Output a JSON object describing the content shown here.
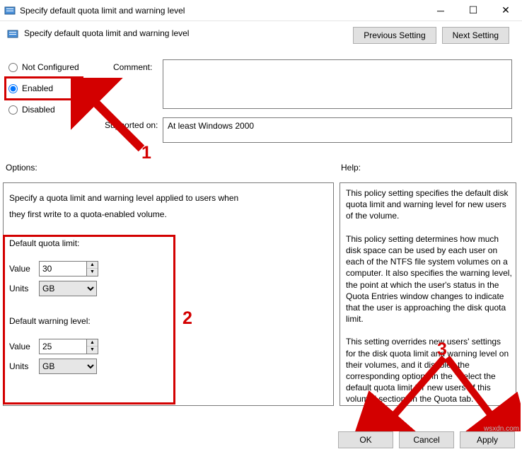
{
  "window": {
    "title": "Specify default quota limit and warning level",
    "subtitle": "Specify default quota limit and warning level"
  },
  "nav": {
    "prev": "Previous Setting",
    "next": "Next Setting"
  },
  "state": {
    "not_configured": "Not Configured",
    "enabled": "Enabled",
    "disabled": "Disabled",
    "selected": "enabled"
  },
  "labels": {
    "comment": "Comment:",
    "supported": "Supported on:",
    "options": "Options:",
    "help": "Help:"
  },
  "comment_value": "",
  "supported_value": "At least Windows 2000",
  "options": {
    "intro_line1": "Specify a quota limit and warning level applied to users when",
    "intro_line2": "they first write to a quota-enabled volume.",
    "limit_label": "Default quota limit:",
    "warn_label": "Default warning level:",
    "value_label": "Value",
    "units_label": "Units",
    "limit_value": "30",
    "limit_units": "GB",
    "warn_value": "25",
    "warn_units": "GB"
  },
  "help_text": "This policy setting specifies the default disk quota limit and warning level for new users of the volume.\n\nThis policy setting determines how much disk space can be used by each user on each of the NTFS file system volumes on a computer. It also specifies the warning level, the point at which the user's status in the Quota Entries window changes to indicate that the user is approaching the disk quota limit.\n\nThis setting overrides new users' settings for the disk quota limit and warning level on their volumes, and it disables the corresponding options in the \"Select the default quota limit for new users of this volume\" section on the Quota tab.\n\nThis policy setting applies to all new users as soon as they write to the volume. It does",
  "buttons": {
    "ok": "OK",
    "cancel": "Cancel",
    "apply": "Apply"
  },
  "annotations": {
    "one": "1",
    "two": "2",
    "three": "3"
  },
  "watermark": "wsxdn.com"
}
